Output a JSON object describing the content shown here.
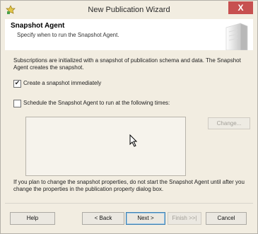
{
  "window": {
    "title": "New Publication Wizard",
    "close_glyph": "X"
  },
  "header": {
    "title": "Snapshot Agent",
    "subtitle": "Specify when to run the Snapshot Agent."
  },
  "body": {
    "intro_line1": "Subscriptions are initialized with a snapshot of publication schema and data. The Snapshot",
    "intro_line2": "Agent creates the snapshot.",
    "create_immediately": {
      "label": "Create a snapshot immediately",
      "checked": true
    },
    "schedule": {
      "label": "Schedule the Snapshot Agent to run at the following times:",
      "checked": false
    },
    "change_button": "Change...",
    "note_line1": "If you plan to change the snapshot properties, do not start the Snapshot Agent until after you",
    "note_line2": "change the properties in the publication property dialog box."
  },
  "buttons": {
    "help": "Help",
    "back": "< Back",
    "next": "Next >",
    "finish": "Finish >>|",
    "cancel": "Cancel"
  },
  "colors": {
    "close_button": "#c75050",
    "window_bg": "#f2ede1",
    "focus_border": "#3c7fb1"
  }
}
